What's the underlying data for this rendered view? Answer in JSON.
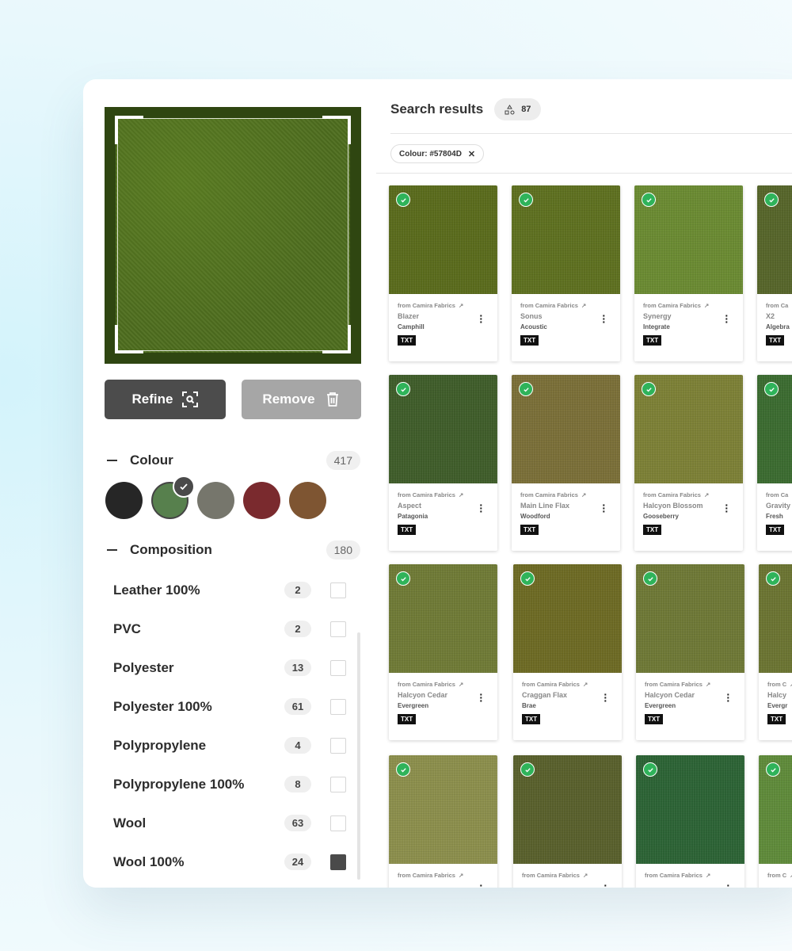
{
  "left": {
    "refine_label": "Refine",
    "remove_label": "Remove",
    "colour": {
      "title": "Colour",
      "count": "417",
      "swatches": [
        {
          "name": "black",
          "hex": "#262626",
          "selected": false
        },
        {
          "name": "green",
          "hex": "#57804D",
          "selected": true
        },
        {
          "name": "grey",
          "hex": "#76766c",
          "selected": false
        },
        {
          "name": "red",
          "hex": "#7a2a2e",
          "selected": false
        },
        {
          "name": "brown",
          "hex": "#7e5532",
          "selected": false
        }
      ]
    },
    "composition": {
      "title": "Composition",
      "count": "180",
      "items": [
        {
          "label": "Leather 100%",
          "count": "2",
          "checked": false
        },
        {
          "label": "PVC",
          "count": "2",
          "checked": false
        },
        {
          "label": "Polyester",
          "count": "13",
          "checked": false
        },
        {
          "label": "Polyester 100%",
          "count": "61",
          "checked": false
        },
        {
          "label": "Polypropylene",
          "count": "4",
          "checked": false
        },
        {
          "label": "Polypropylene 100%",
          "count": "8",
          "checked": false
        },
        {
          "label": "Wool",
          "count": "63",
          "checked": false
        },
        {
          "label": "Wool 100%",
          "count": "24",
          "checked": true
        }
      ]
    }
  },
  "results": {
    "title": "Search results",
    "count": "87",
    "filter_chip": "Colour: #57804D",
    "tiles": [
      {
        "from": "from Camira Fabrics",
        "name": "Blazer",
        "sub": "Camphill",
        "tag": "TXT",
        "color": "#5a6b1c"
      },
      {
        "from": "from Camira Fabrics",
        "name": "Sonus",
        "sub": "Acoustic",
        "tag": "TXT",
        "color": "#5e7020"
      },
      {
        "from": "from Camira Fabrics",
        "name": "Synergy",
        "sub": "Integrate",
        "tag": "TXT",
        "color": "#6a8a32"
      },
      {
        "from": "from Ca",
        "name": "X2",
        "sub": "Algebra",
        "tag": "TXT",
        "color": "#56652a"
      },
      {
        "from": "from Camira Fabrics",
        "name": "Aspect",
        "sub": "Patagonia",
        "tag": "TXT",
        "color": "#3f5d2a"
      },
      {
        "from": "from Camira Fabrics",
        "name": "Main Line Flax",
        "sub": "Woodford",
        "tag": "TXT",
        "color": "#7a6f38"
      },
      {
        "from": "from Camira Fabrics",
        "name": "Halcyon Blossom",
        "sub": "Gooseberry",
        "tag": "TXT",
        "color": "#7c8036"
      },
      {
        "from": "from Ca",
        "name": "Gravity",
        "sub": "Fresh",
        "tag": "TXT",
        "color": "#3b6b30"
      },
      {
        "from": "from Camira Fabrics",
        "name": "Halcyon Cedar",
        "sub": "Evergreen",
        "tag": "TXT",
        "color": "#6f7a36"
      },
      {
        "from": "from Camira Fabrics",
        "name": "Craggan Flax",
        "sub": "Brae",
        "tag": "TXT",
        "color": "#6d6a24"
      },
      {
        "from": "from Camira Fabrics",
        "name": "Halcyon Cedar",
        "sub": "Evergreen",
        "tag": "TXT",
        "color": "#6e7836"
      },
      {
        "from": "from C",
        "name": "Halcy",
        "sub": "Evergr",
        "tag": "TXT",
        "color": "#6b7432"
      },
      {
        "from": "from Camira Fabrics",
        "name": "",
        "sub": "",
        "tag": "",
        "color": "#8b8e4c"
      },
      {
        "from": "from Camira Fabrics",
        "name": "",
        "sub": "",
        "tag": "",
        "color": "#59602c"
      },
      {
        "from": "from Camira Fabrics",
        "name": "",
        "sub": "",
        "tag": "",
        "color": "#2c6335"
      },
      {
        "from": "from C",
        "name": "",
        "sub": "",
        "tag": "",
        "color": "#5f8a3a"
      }
    ]
  }
}
